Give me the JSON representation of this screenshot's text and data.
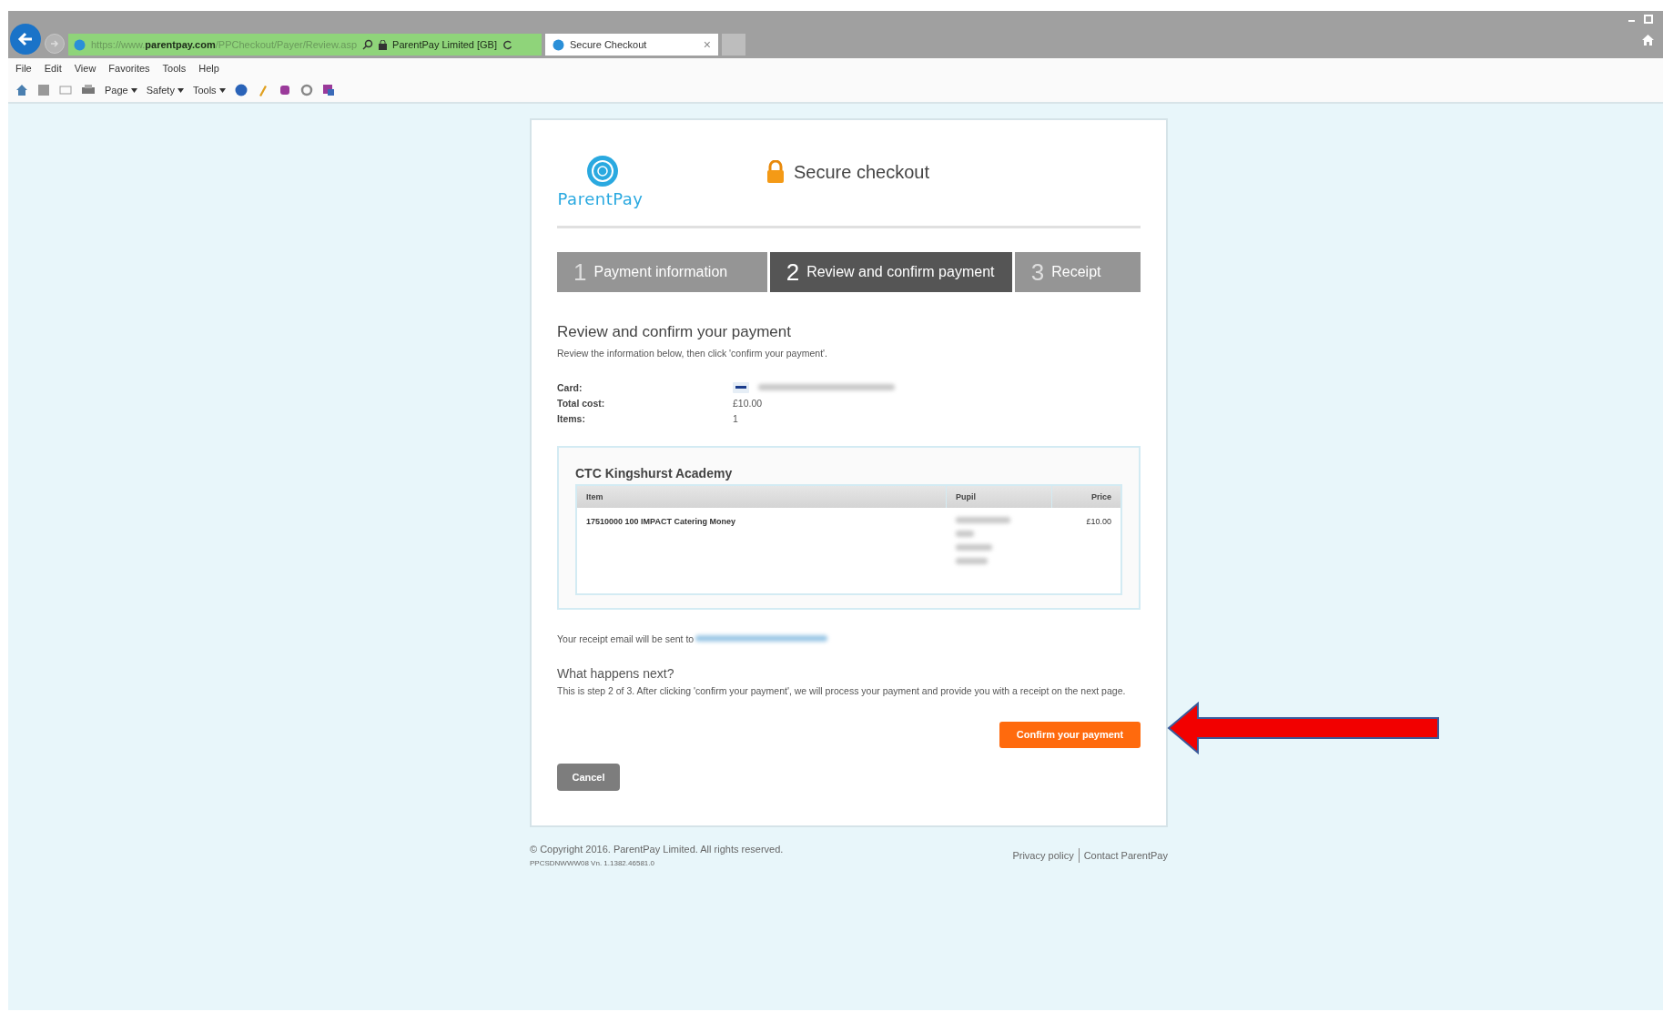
{
  "browser": {
    "address": "https://www.**parentpay.com**/PPCheckout/Payer/Review.asp",
    "site_identity": "ParentPay Limited [GB]",
    "tabs": [
      {
        "title": "Secure Checkout",
        "close": "×",
        "selected": true
      }
    ],
    "menu": [
      "File",
      "Edit",
      "View",
      "Favorites",
      "Tools",
      "Help"
    ],
    "commands": [
      "Page",
      "Safety",
      "Tools"
    ]
  },
  "header": {
    "logo": "ParentPay",
    "title": "Secure checkout"
  },
  "steps": [
    {
      "number": "1",
      "label": "Payment information",
      "selected": false
    },
    {
      "number": "2",
      "label": "Review and confirm payment",
      "selected": true
    },
    {
      "number": "3",
      "label": "Receipt",
      "selected": false
    }
  ],
  "review": {
    "heading": "Review and confirm your payment",
    "instructions": "Review the information below, then click 'confirm your payment'.",
    "details": [
      {
        "label": "Card:",
        "kind": "card"
      },
      {
        "label": "Total cost:",
        "value": "£10.00",
        "kind": "text"
      },
      {
        "label": "Items:",
        "value": "1",
        "kind": "text"
      }
    ]
  },
  "order": {
    "school": "CTC Kingshurst Academy",
    "columns": [
      "Item",
      "Pupil",
      "Price"
    ],
    "rows": [
      {
        "item": "17510000 100 IMPACT Catering Money",
        "price": "£10.00"
      }
    ]
  },
  "receipt_note": "Your receipt email will be sent to",
  "next": {
    "heading": "What happens next?",
    "text": "This is step 2 of 3. After clicking 'confirm your payment', we will process your payment and provide you with a receipt on the next page."
  },
  "buttons": {
    "confirm": "Confirm your payment",
    "cancel": "Cancel"
  },
  "footer": {
    "copyright": "© Copyright 2016. ParentPay Limited. All rights reserved.",
    "version": "PPCSDNWWW08 Vn. 1.1382.46581.0",
    "links": [
      "Privacy policy",
      "Contact ParentPay"
    ]
  }
}
